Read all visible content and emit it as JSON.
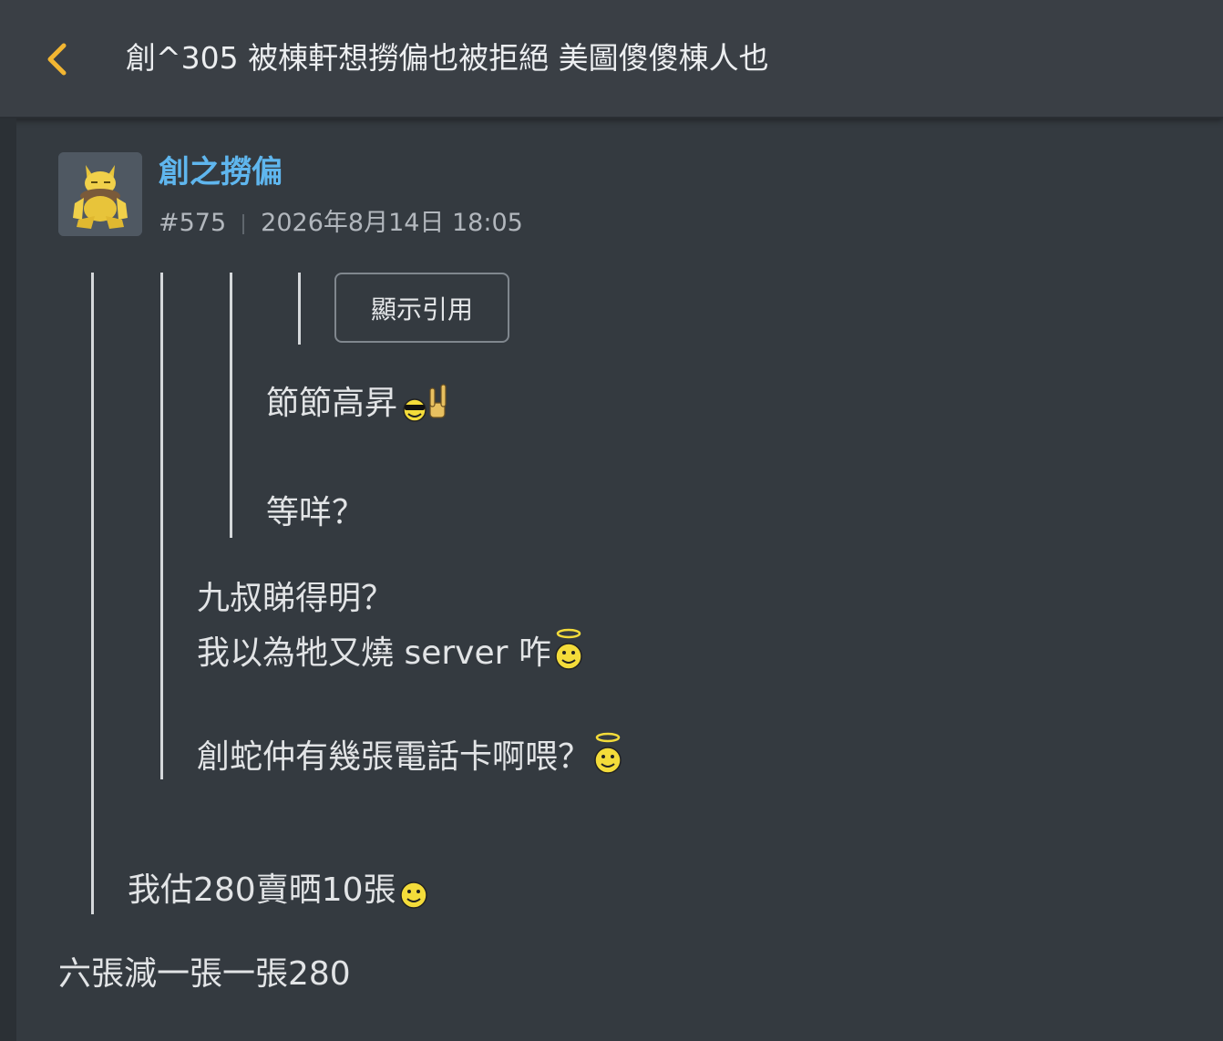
{
  "header": {
    "back_icon": "chevron-left-icon",
    "title": "創^305 被棟軒想撈偏也被拒絕 美圖傻傻棟人也",
    "accent": "#f2b632"
  },
  "post": {
    "username": "創之撈偏",
    "post_number": "#575",
    "timestamp": "2026年8月14日 18:05",
    "username_color": "#5fb6ee",
    "quote_button_label": "顯示引用",
    "quote_level3": {
      "line1": "節節高昇",
      "line1_emojis": [
        "sunglasses-smiley-icon",
        "rock-hand-icon"
      ],
      "line2": "等咩？"
    },
    "quote_level2": {
      "line1": "九叔睇得明？",
      "line2": "我以為牠又燒 server 咋",
      "line2_emoji": "angel-smiley-icon",
      "line3": "創蛇仲有幾張電話卡啊喂？",
      "line3_emoji": "angel-smiley-icon"
    },
    "quote_level1": {
      "line1": "我估280賣晒10張",
      "line1_emoji": "smiley-icon"
    },
    "body": "六張減一張一張280"
  }
}
